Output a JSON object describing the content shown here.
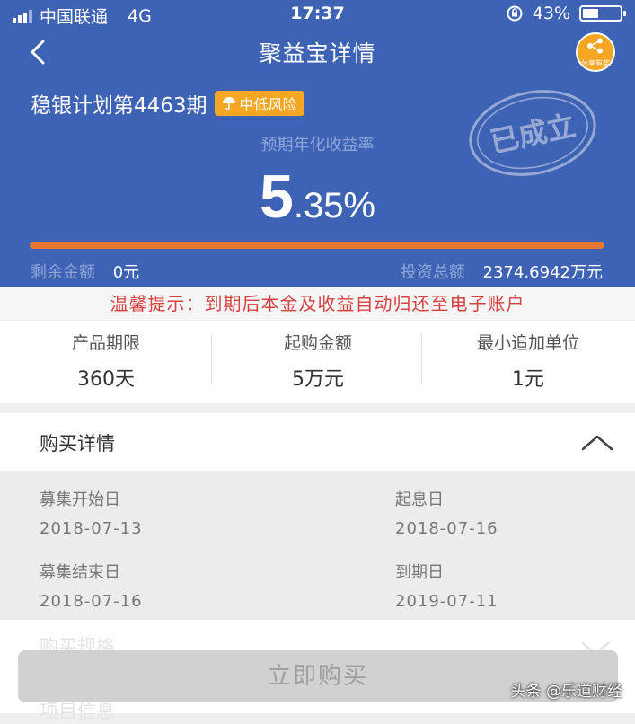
{
  "status_bar": {
    "carrier": "中国联通",
    "network": "4G",
    "time": "17:37",
    "battery": "43%",
    "battery_level": 0.43
  },
  "nav": {
    "title": "聚益宝详情",
    "back_icon": "back-arrow-icon",
    "share_icon": "share-icon",
    "share_text": "分享有奖"
  },
  "product": {
    "name": "稳银计划第4463期",
    "risk": "中低风险",
    "stamp": "已成立"
  },
  "rate": {
    "label": "预期年化收益率",
    "integer": "5",
    "decimal": ".35%"
  },
  "progress": 1.0,
  "amounts": {
    "remaining_label": "剩余金额",
    "remaining_value": "0元",
    "total_label": "投资总额",
    "total_value": "2374.6942万元"
  },
  "notice": "温馨提示：到期后本金及收益自动归还至电子账户",
  "stats": [
    {
      "label": "产品期限",
      "value": "360天"
    },
    {
      "label": "起购金额",
      "value": "5万元"
    },
    {
      "label": "最小追加单位",
      "value": "1元"
    }
  ],
  "purchase_details": {
    "title": "购买详情",
    "items": [
      {
        "label": "募集开始日",
        "value": "2018-07-13"
      },
      {
        "label": "起息日",
        "value": "2018-07-16"
      },
      {
        "label": "募集结束日",
        "value": "2018-07-16"
      },
      {
        "label": "到期日",
        "value": "2019-07-11"
      }
    ]
  },
  "faded_sections": [
    "购买规格",
    "项目信息"
  ],
  "buy_button": "立即购买",
  "watermark": "头条 @乐道财经",
  "colors": {
    "header": "#3f63b4",
    "accent": "#f5a623",
    "progress": "#e8762e",
    "notice": "#d64040"
  }
}
